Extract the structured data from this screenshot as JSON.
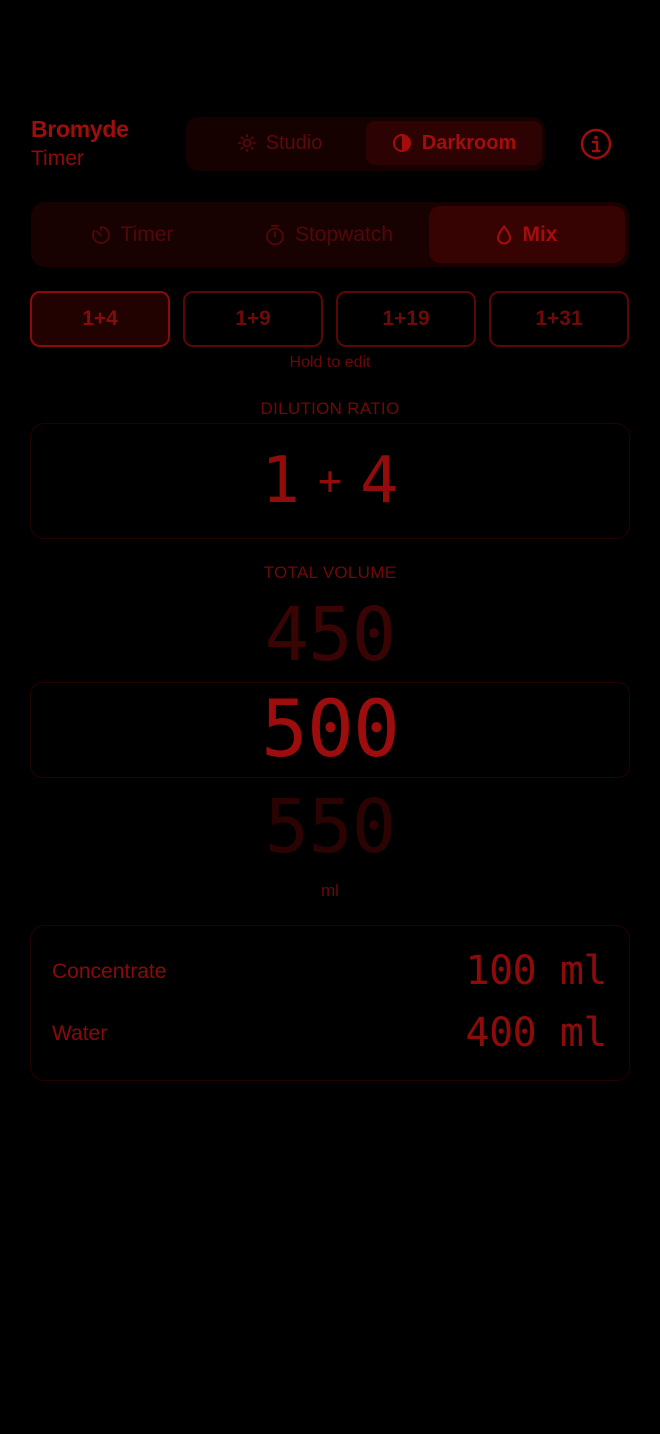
{
  "app": {
    "title": "Bromyde",
    "subtitle": "Timer"
  },
  "mode_switch": {
    "options": [
      {
        "label": "Studio",
        "icon": "sun-icon",
        "selected": false
      },
      {
        "label": "Darkroom",
        "icon": "contrast-icon",
        "selected": true
      }
    ]
  },
  "info_icon": "info-icon",
  "tabs": [
    {
      "label": "Timer",
      "icon": "timer-icon",
      "selected": false
    },
    {
      "label": "Stopwatch",
      "icon": "stopwatch-icon",
      "selected": false
    },
    {
      "label": "Mix",
      "icon": "drop-icon",
      "selected": true
    }
  ],
  "presets": {
    "items": [
      "1+4",
      "1+9",
      "1+19",
      "1+31"
    ],
    "selected": "1+4",
    "hint": "Hold to edit"
  },
  "dilution": {
    "label": "DILUTION RATIO",
    "concentrate_part": "1",
    "plus": "+",
    "water_part": "4"
  },
  "volume": {
    "label": "TOTAL VOLUME",
    "previous": "450",
    "current": "500",
    "next": "550",
    "unit": "ml"
  },
  "result": {
    "concentrate_label": "Concentrate",
    "concentrate_value": "100 ml",
    "water_label": "Water",
    "water_value": "400 ml"
  },
  "colors": {
    "background": "#000000",
    "accent": "#a00d0d",
    "dim": "#5e0909"
  }
}
